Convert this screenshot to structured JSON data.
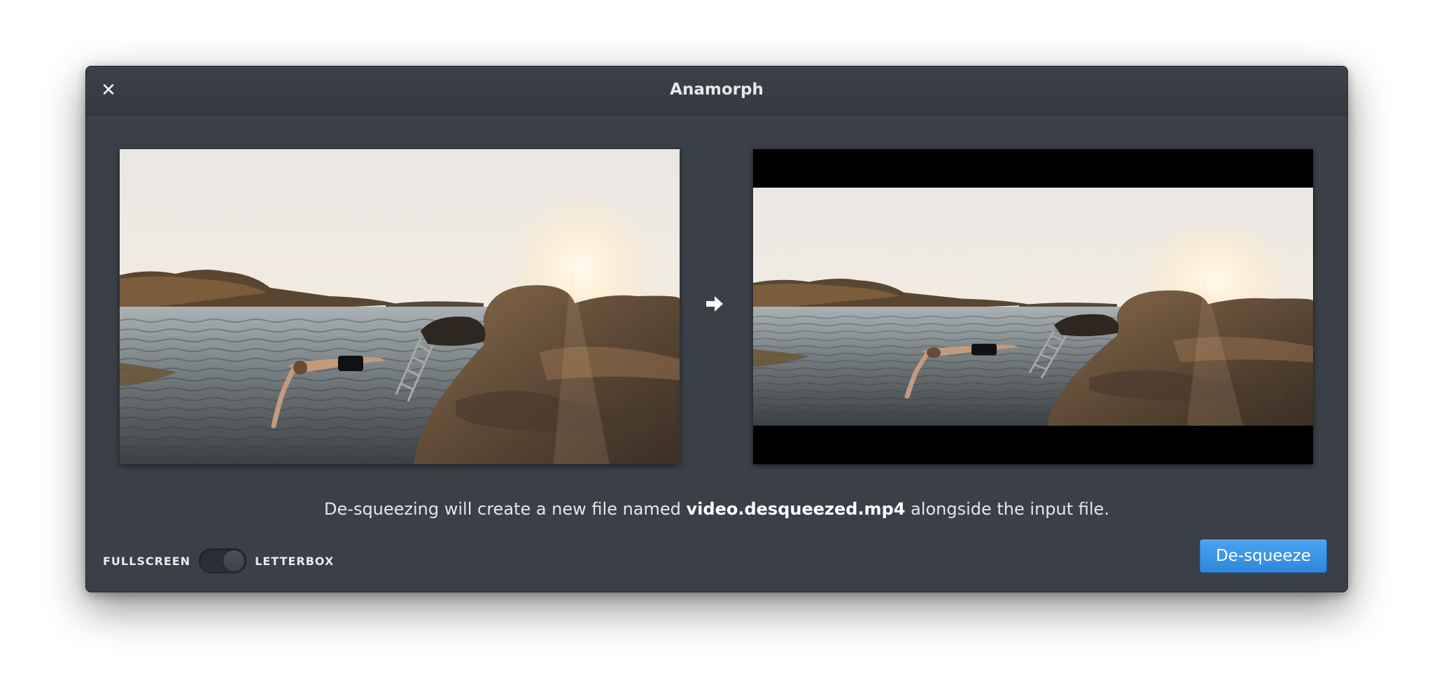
{
  "window": {
    "title": "Anamorph"
  },
  "titlebar": {
    "close_icon": "close-icon",
    "close_glyph": "✕"
  },
  "previews": {
    "arrow_icon": "arrow-right-icon"
  },
  "info": {
    "prefix": "De-squeezing will create a new file named ",
    "filename": "video.desqueezed.mp4",
    "suffix": " alongside the input file."
  },
  "mode": {
    "left_label": "FULLSCREEN",
    "right_label": "LETTERBOX",
    "selected": "LETTERBOX"
  },
  "actions": {
    "desqueeze_label": "De-squeeze"
  },
  "colors": {
    "window_bg": "#3b3f47",
    "accent": "#3d96e6",
    "letterbox": "#000000"
  }
}
